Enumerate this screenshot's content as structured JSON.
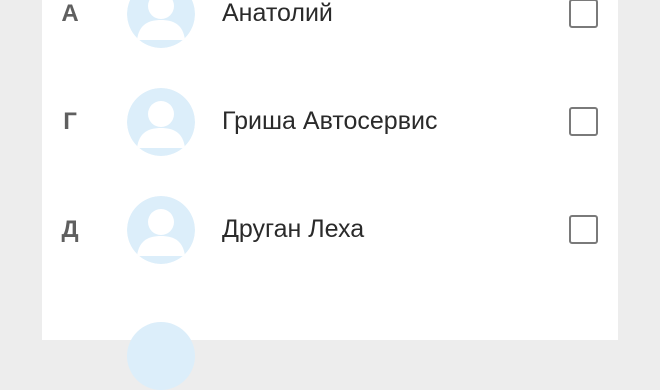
{
  "contacts": [
    {
      "letter": "А",
      "name": "Анатолий",
      "checked": false
    },
    {
      "letter": "Г",
      "name": "Гриша Автосервис",
      "checked": false
    },
    {
      "letter": "Д",
      "name": "Друган Леха",
      "checked": false
    }
  ],
  "colors": {
    "avatar_background": "#dceefa",
    "avatar_silhouette": "#ffffff",
    "checkbox_border": "#7a7a7a"
  },
  "icons": {
    "avatar": "person-silhouette-icon",
    "checkbox": "checkbox-unchecked-icon"
  }
}
